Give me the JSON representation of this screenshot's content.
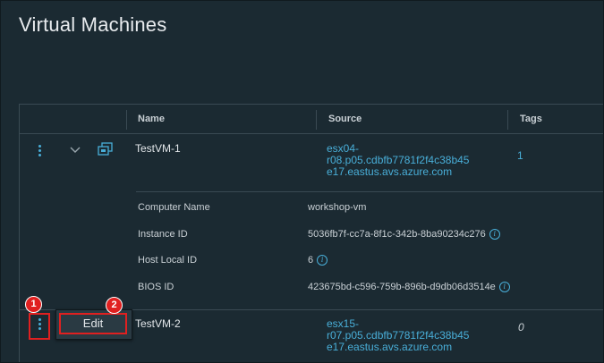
{
  "page": {
    "title": "Virtual Machines"
  },
  "table": {
    "columns": [
      "Name",
      "Source",
      "Tags"
    ],
    "rows": [
      {
        "name": "TestVM-1",
        "source": [
          "esx04-",
          "r08.p05.cdbfb7781f2f4c38b45",
          "e17.eastus.avs.azure.com"
        ],
        "tags": "1",
        "expanded": true,
        "details": [
          {
            "label": "Computer Name",
            "value": "workshop-vm",
            "info": false
          },
          {
            "label": "Instance ID",
            "value": "5036fb7f-cc7a-8f1c-342b-8ba90234c276",
            "info": true
          },
          {
            "label": "Host Local ID",
            "value": "6",
            "info": true
          },
          {
            "label": "BIOS ID",
            "value": "423675bd-c596-759b-896b-d9db06d3514e",
            "info": true
          }
        ]
      },
      {
        "name": "TestVM-2",
        "source": [
          "esx15-",
          "r07.p05.cdbfb7781f2f4c38b45",
          "e17.eastus.avs.azure.com"
        ],
        "tags": "0",
        "expanded": false
      }
    ]
  },
  "context_menu": {
    "edit_label": "Edit"
  },
  "callouts": [
    "1",
    "2"
  ],
  "icons": {
    "info": "i",
    "expand": "chevron-down-icon",
    "vm": "vm-icon",
    "actions": "kebab-menu-icon"
  },
  "colors": {
    "accent": "#49afd9",
    "callout": "#e02020",
    "background": "#1b2a32"
  }
}
